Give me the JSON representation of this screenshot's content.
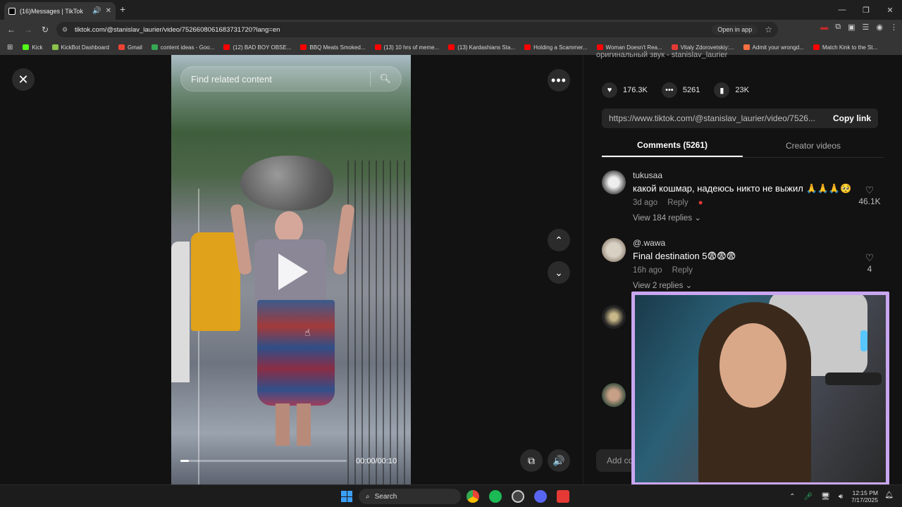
{
  "browser": {
    "tab_title": "(16)Messages | TikTok",
    "url": "tiktok.com/@stanislav_laurier/video/7526608061683731720?lang=en",
    "open_in_app": "Open in app",
    "bookmarks": [
      {
        "label": "",
        "color": "#ffffff"
      },
      {
        "label": "Kick",
        "color": "#53fc18"
      },
      {
        "label": "KickBot Dashboard",
        "color": "#8bc34a"
      },
      {
        "label": "Gmail",
        "color": "#ea4335"
      },
      {
        "label": "content ideas - Goo...",
        "color": "#34a853"
      },
      {
        "label": "(12) BAD BOY OBSE...",
        "color": "#ff0000"
      },
      {
        "label": "BBQ Meats Smoked...",
        "color": "#ff0000"
      },
      {
        "label": "(13) 10 hrs of meme...",
        "color": "#ff0000"
      },
      {
        "label": "(13) Kardashians Sta...",
        "color": "#ff0000"
      },
      {
        "label": "Holding a Scammer...",
        "color": "#ff0000"
      },
      {
        "label": "Woman Doesn't Rea...",
        "color": "#ff0000"
      },
      {
        "label": "Vitaly Zdorovetskiy:...",
        "color": "#e53935"
      },
      {
        "label": "Admit your wrongd...",
        "color": "#ff7043"
      },
      {
        "label": "Match Kink to the St...",
        "color": "#ff0000"
      }
    ]
  },
  "video": {
    "search_placeholder": "Find related content",
    "time": "00:00/00:10",
    "progress": 0.05
  },
  "panel": {
    "sound": "оригинальный звук - stanislav_laurier",
    "likes": "176.3K",
    "comments_count": "5261",
    "saves": "23K",
    "link": "https://www.tiktok.com/@stanislav_laurier/video/7526...",
    "copy_link": "Copy link",
    "tab_comments": "Comments (5261)",
    "tab_creator": "Creator videos",
    "comments": [
      {
        "name": "tukusaa",
        "text": "какой кошмар, надеюсь никто не выжил 🙏🙏🙏🥺",
        "time": "3d ago",
        "reply": "Reply",
        "replies": "View 184 replies",
        "likes": "46.1K"
      },
      {
        "name": "@.wawa",
        "text": "Final destination 5😨😨😨",
        "time": "16h ago",
        "reply": "Reply",
        "replies": "View 2 replies",
        "likes": "4"
      }
    ],
    "add_comment": "Add co"
  },
  "taskbar": {
    "search": "Search",
    "time": "12:15 PM",
    "date": "7/17/2025"
  }
}
